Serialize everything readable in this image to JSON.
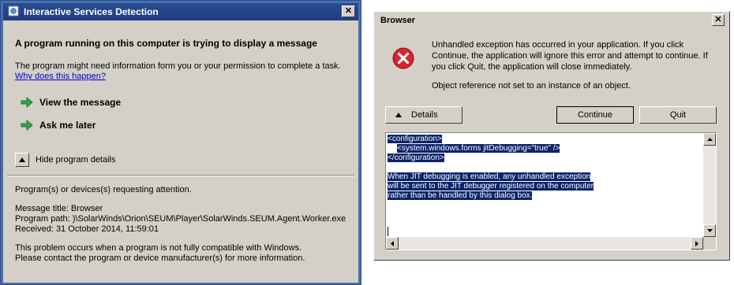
{
  "isd": {
    "title": "Interactive Services Detection",
    "close_glyph": "✕",
    "heading": "A program running on this computer is trying to display a message",
    "info_text": "The program might need information form you or your permission to complete a task.",
    "why_link": "Why does this happen?",
    "actions": [
      {
        "label": "View the message"
      },
      {
        "label": "Ask me later"
      }
    ],
    "toggle_label": "Hide program details",
    "details": {
      "attention": "Program(s) or devices(s) requesting attention.",
      "message_title": "Message title:  Browser",
      "program_path": "Program path:  )\\SolarWinds\\Orion\\SEUM\\Player\\SolarWinds.SEUM.Agent.Worker.exe",
      "received": "Received:  31 October 2014, 11:59:01",
      "compat_line1": "This problem occurs when a program is not fully compatible with Windows.",
      "compat_line2": "Please contact the program or device manufacturer(s) for more information."
    },
    "colors": {
      "frame": "#4a6fb0",
      "title_bar": "#1f3d7e",
      "arrow": "#2ea84a"
    }
  },
  "browser": {
    "title": "Browser",
    "close_glyph": "✕",
    "message_line1": "Unhandled exception has occurred in your application. If you click Continue, the application will ignore this error and attempt to continue. If you click Quit, the application will close immediately.",
    "message_line2": "Object reference not set to an instance of an object.",
    "buttons": {
      "details": "Details",
      "continue": "Continue",
      "quit": "Quit"
    },
    "textarea": {
      "line1": "<configuration>",
      "line2": "<system.windows.forms jitDebugging=\"true\" />",
      "line3": "</configuration>",
      "line4": "When JIT debugging is enabled, any unhandled exception",
      "line5": "will be sent to the JIT debugger registered on the computer",
      "line6": "rather than be handled by this dialog box."
    },
    "icons": {
      "error": "error-icon",
      "details_toggle": "triangle-up-icon"
    },
    "colors": {
      "error_red": "#d8232a",
      "selection": "#0a246a"
    }
  }
}
